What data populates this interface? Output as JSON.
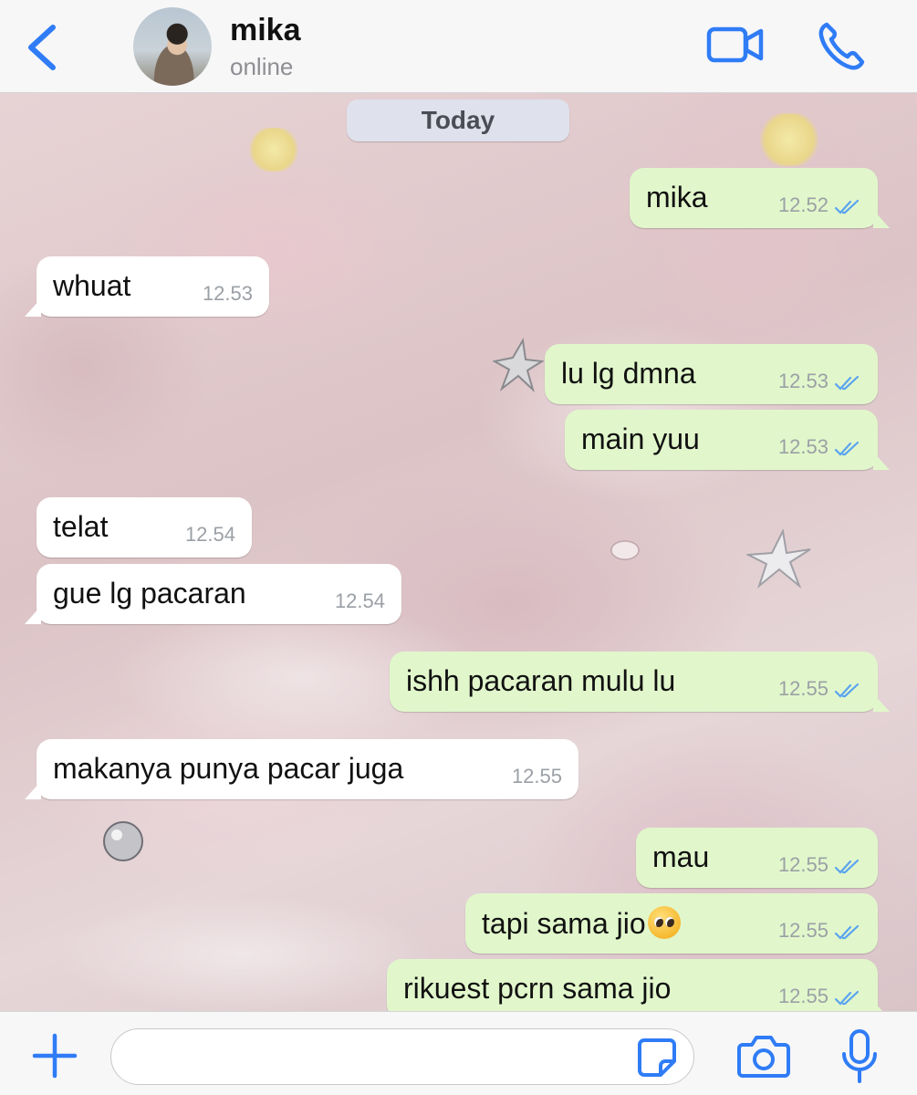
{
  "header": {
    "contact_name": "mika",
    "status": "online",
    "accent_color": "#2f7cf6",
    "icons": [
      "chevron-left-icon",
      "avatar",
      "video-call-icon",
      "phone-call-icon"
    ]
  },
  "chat": {
    "date_chip": "Today",
    "messages": [
      {
        "direction": "out",
        "text": "mika",
        "time": "12.52",
        "status": "read"
      },
      {
        "direction": "in",
        "text": "whuat",
        "time": "12.53"
      },
      {
        "direction": "out",
        "text": "lu lg dmna",
        "time": "12.53",
        "status": "read"
      },
      {
        "direction": "out",
        "text": "main yuu",
        "time": "12.53",
        "status": "read"
      },
      {
        "direction": "in",
        "text": "telat",
        "time": "12.54"
      },
      {
        "direction": "in",
        "text": "gue lg pacaran",
        "time": "12.54"
      },
      {
        "direction": "out",
        "text": "ishh pacaran mulu lu",
        "time": "12.55",
        "status": "read"
      },
      {
        "direction": "in",
        "text": "makanya punya pacar juga",
        "time": "12.55"
      },
      {
        "direction": "out",
        "text": "mau",
        "time": "12.55",
        "status": "read"
      },
      {
        "direction": "out",
        "text": "tapi sama jio",
        "emoji": "pleading-face",
        "time": "12.55",
        "status": "read"
      },
      {
        "direction": "out",
        "text": "rikuest pcrn sama jio",
        "time": "12.55",
        "status": "read"
      }
    ],
    "colors": {
      "outgoing": "#e1f7cb",
      "incoming": "#ffffff",
      "read_ticks": "#5aa3f0"
    }
  },
  "composer": {
    "input_value": "",
    "icons": [
      "plus-icon",
      "sticker-icon",
      "camera-icon",
      "microphone-icon"
    ]
  }
}
